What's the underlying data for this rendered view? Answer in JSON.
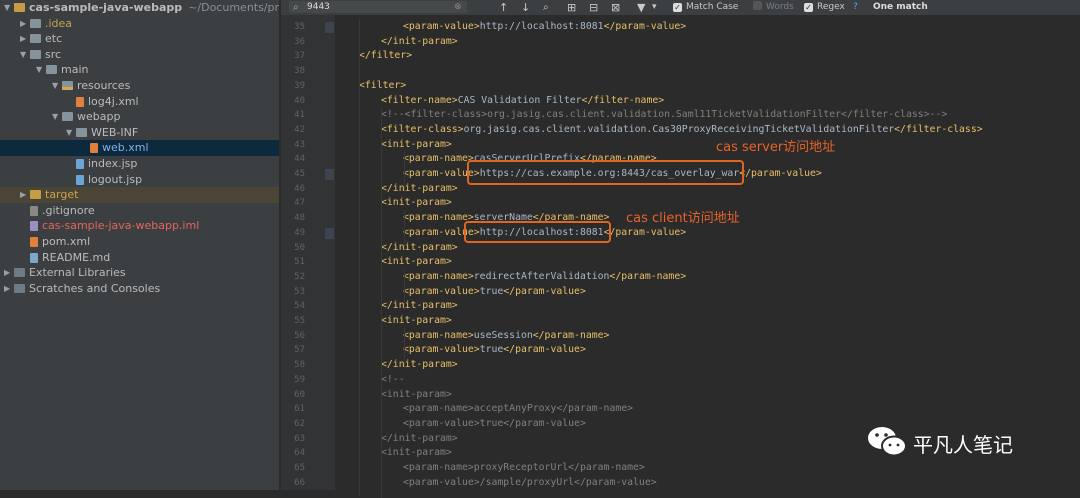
{
  "project_tree": {
    "items": [
      {
        "label": "cas-sample-java-webapp",
        "suffix": "~/Documents/projec",
        "kind": "folder-gold",
        "arrow": "▼"
      },
      {
        "label": ".idea",
        "kind": "folder",
        "arrow": "▶",
        "color": "gold"
      },
      {
        "label": "etc",
        "kind": "folder",
        "arrow": "▶"
      },
      {
        "label": "src",
        "kind": "folder",
        "arrow": "▼"
      },
      {
        "label": "main",
        "kind": "folder",
        "arrow": "▼"
      },
      {
        "label": "resources",
        "kind": "folder-res",
        "arrow": "▼"
      },
      {
        "label": "log4j.xml",
        "kind": "xml"
      },
      {
        "label": "webapp",
        "kind": "folder",
        "arrow": "▼"
      },
      {
        "label": "WEB-INF",
        "kind": "folder",
        "arrow": "▼"
      },
      {
        "label": "web.xml",
        "kind": "xml",
        "selected": true,
        "color": "blue"
      },
      {
        "label": "index.jsp",
        "kind": "jsp"
      },
      {
        "label": "logout.jsp",
        "kind": "jsp"
      },
      {
        "label": "target",
        "kind": "folder-gold",
        "arrow": "▶",
        "color": "gold",
        "highlight": true
      },
      {
        "label": ".gitignore",
        "kind": "git"
      },
      {
        "label": "cas-sample-java-webapp.iml",
        "kind": "iml",
        "color": "red"
      },
      {
        "label": "pom.xml",
        "kind": "pom"
      },
      {
        "label": "README.md",
        "kind": "md"
      },
      {
        "label": "External Libraries",
        "kind": "lib",
        "arrow": "▶"
      },
      {
        "label": "Scratches and Consoles",
        "kind": "lib",
        "arrow": "▶"
      }
    ]
  },
  "search": {
    "query": "9443",
    "match_case_label": "Match Case",
    "match_case_checked": true,
    "words_label": "Words",
    "words_checked": false,
    "regex_label": "Regex",
    "regex_checked": true,
    "help_label": "?",
    "result_label": "One match"
  },
  "editor": {
    "lines": [
      {
        "num": "35",
        "indent": 3,
        "parts": [
          [
            "t",
            "<param-value>"
          ],
          [
            "v",
            "http://localhost:8081"
          ],
          [
            "t",
            "</param-value>"
          ]
        ]
      },
      {
        "num": "36",
        "indent": 2,
        "parts": [
          [
            "t",
            "</init-param>"
          ]
        ]
      },
      {
        "num": "37",
        "indent": 1,
        "parts": [
          [
            "t",
            "</filter>"
          ]
        ]
      },
      {
        "num": "38",
        "indent": 0,
        "parts": []
      },
      {
        "num": "39",
        "indent": 1,
        "parts": [
          [
            "t",
            "<filter>"
          ]
        ]
      },
      {
        "num": "40",
        "indent": 2,
        "parts": [
          [
            "t",
            "<filter-name>"
          ],
          [
            "v",
            "CAS Validation Filter"
          ],
          [
            "t",
            "</filter-name>"
          ]
        ]
      },
      {
        "num": "41",
        "indent": 2,
        "parts": [
          [
            "c",
            "<!--<filter-class>org.jasig.cas.client.validation.Saml11TicketValidationFilter</filter-class>-->"
          ]
        ]
      },
      {
        "num": "42",
        "indent": 2,
        "parts": [
          [
            "t",
            "<filter-class>"
          ],
          [
            "v",
            "org.jasig.cas.client.validation.Cas30ProxyReceivingTicketValidationFilter"
          ],
          [
            "t",
            "</filter-class>"
          ]
        ]
      },
      {
        "num": "43",
        "indent": 2,
        "parts": [
          [
            "t",
            "<init-param>"
          ]
        ]
      },
      {
        "num": "44",
        "indent": 3,
        "parts": [
          [
            "t",
            "<param-name>"
          ],
          [
            "v",
            "casServerUrlPrefix"
          ],
          [
            "t",
            "</param-name>"
          ]
        ]
      },
      {
        "num": "45",
        "indent": 3,
        "parts": [
          [
            "t",
            "<param-value>"
          ],
          [
            "v",
            "https://cas.example.org:8443/cas_overlay_war"
          ],
          [
            "t",
            "</param-value>"
          ]
        ]
      },
      {
        "num": "46",
        "indent": 2,
        "parts": [
          [
            "t",
            "</init-param>"
          ]
        ]
      },
      {
        "num": "47",
        "indent": 2,
        "parts": [
          [
            "t",
            "<init-param>"
          ]
        ]
      },
      {
        "num": "48",
        "indent": 3,
        "parts": [
          [
            "t",
            "<param-name>"
          ],
          [
            "v",
            "serverName"
          ],
          [
            "t",
            "</param-name>"
          ]
        ]
      },
      {
        "num": "49",
        "indent": 3,
        "parts": [
          [
            "t",
            "<param-value>"
          ],
          [
            "v",
            "http://localhost:8081"
          ],
          [
            "t",
            "</param-value>"
          ]
        ]
      },
      {
        "num": "50",
        "indent": 2,
        "parts": [
          [
            "t",
            "</init-param>"
          ]
        ]
      },
      {
        "num": "51",
        "indent": 2,
        "parts": [
          [
            "t",
            "<init-param>"
          ]
        ]
      },
      {
        "num": "52",
        "indent": 3,
        "parts": [
          [
            "t",
            "<param-name>"
          ],
          [
            "v",
            "redirectAfterValidation"
          ],
          [
            "t",
            "</param-name>"
          ]
        ]
      },
      {
        "num": "53",
        "indent": 3,
        "parts": [
          [
            "t",
            "<param-value>"
          ],
          [
            "v",
            "true"
          ],
          [
            "t",
            "</param-value>"
          ]
        ]
      },
      {
        "num": "54",
        "indent": 2,
        "parts": [
          [
            "t",
            "</init-param>"
          ]
        ]
      },
      {
        "num": "55",
        "indent": 2,
        "parts": [
          [
            "t",
            "<init-param>"
          ]
        ]
      },
      {
        "num": "56",
        "indent": 3,
        "parts": [
          [
            "t",
            "<param-name>"
          ],
          [
            "v",
            "useSession"
          ],
          [
            "t",
            "</param-name>"
          ]
        ]
      },
      {
        "num": "57",
        "indent": 3,
        "parts": [
          [
            "t",
            "<param-value>"
          ],
          [
            "v",
            "true"
          ],
          [
            "t",
            "</param-value>"
          ]
        ]
      },
      {
        "num": "58",
        "indent": 2,
        "parts": [
          [
            "t",
            "</init-param>"
          ]
        ]
      },
      {
        "num": "59",
        "indent": 2,
        "parts": [
          [
            "c",
            "<!--"
          ]
        ]
      },
      {
        "num": "60",
        "indent": 2,
        "parts": [
          [
            "c",
            "<init-param>"
          ]
        ]
      },
      {
        "num": "61",
        "indent": 3,
        "parts": [
          [
            "c",
            "<param-name>acceptAnyProxy</param-name>"
          ]
        ]
      },
      {
        "num": "62",
        "indent": 3,
        "parts": [
          [
            "c",
            "<param-value>true</param-value>"
          ]
        ]
      },
      {
        "num": "63",
        "indent": 2,
        "parts": [
          [
            "c",
            "</init-param>"
          ]
        ]
      },
      {
        "num": "64",
        "indent": 2,
        "parts": [
          [
            "c",
            "<init-param>"
          ]
        ]
      },
      {
        "num": "65",
        "indent": 3,
        "parts": [
          [
            "c",
            "<param-name>proxyReceptorUrl</param-name>"
          ]
        ]
      },
      {
        "num": "66",
        "indent": 3,
        "parts": [
          [
            "c",
            "<param-value>/sample/proxyUrl</param-value>"
          ]
        ]
      }
    ]
  },
  "annotations": {
    "server_label": "cas server访问地址",
    "client_label": "cas client访问地址"
  },
  "watermark": {
    "text": "平凡人笔记"
  }
}
